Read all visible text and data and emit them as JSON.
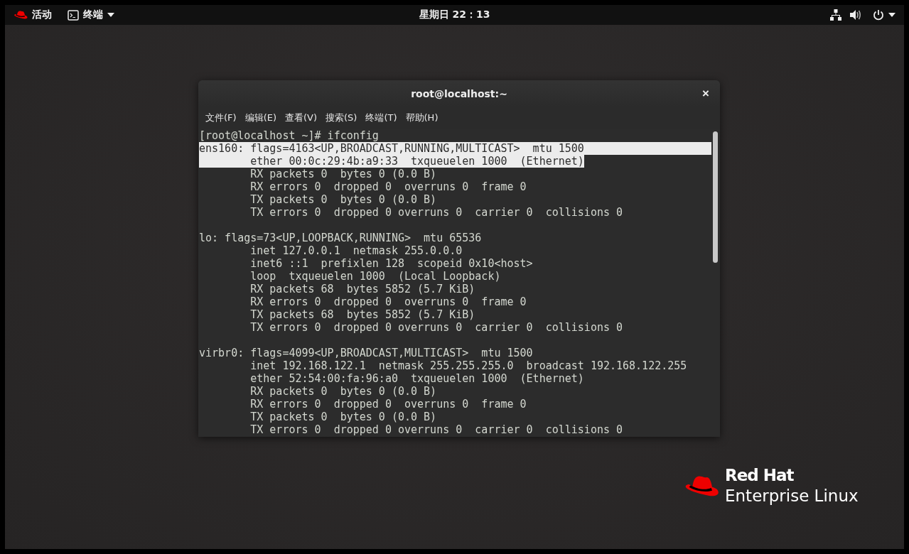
{
  "top_bar": {
    "activities": "活动",
    "app_menu": "终端",
    "clock": "星期日 22：13"
  },
  "window": {
    "title": "root@localhost:~",
    "close": "×",
    "menu": [
      "文件(F)",
      "编辑(E)",
      "查看(V)",
      "搜索(S)",
      "终端(T)",
      "帮助(H)"
    ],
    "lines": [
      {
        "kind": "text",
        "text": "[root@localhost ~]# ifconfig",
        "selected": false
      },
      {
        "kind": "text",
        "text": "ens160: flags=4163<UP,BROADCAST,RUNNING,MULTICAST>  mtu 1500",
        "selected": true
      },
      {
        "kind": "text",
        "text": "        ether 00:0c:29:4b:a9:33  txqueuelen 1000  (Ethernet)",
        "selected": true
      },
      {
        "kind": "text",
        "text": "        RX packets 0  bytes 0 (0.0 B)",
        "selected": false
      },
      {
        "kind": "text",
        "text": "        RX errors 0  dropped 0  overruns 0  frame 0",
        "selected": false
      },
      {
        "kind": "text",
        "text": "        TX packets 0  bytes 0 (0.0 B)",
        "selected": false
      },
      {
        "kind": "text",
        "text": "        TX errors 0  dropped 0 overruns 0  carrier 0  collisions 0",
        "selected": false
      },
      {
        "kind": "blank",
        "selected": false
      },
      {
        "kind": "text",
        "text": "lo: flags=73<UP,LOOPBACK,RUNNING>  mtu 65536",
        "selected": false
      },
      {
        "kind": "text",
        "text": "        inet 127.0.0.1  netmask 255.0.0.0",
        "selected": false
      },
      {
        "kind": "text",
        "text": "        inet6 ::1  prefixlen 128  scopeid 0x10<host>",
        "selected": false
      },
      {
        "kind": "text",
        "text": "        loop  txqueuelen 1000  (Local Loopback)",
        "selected": false
      },
      {
        "kind": "text",
        "text": "        RX packets 68  bytes 5852 (5.7 KiB)",
        "selected": false
      },
      {
        "kind": "text",
        "text": "        RX errors 0  dropped 0  overruns 0  frame 0",
        "selected": false
      },
      {
        "kind": "text",
        "text": "        TX packets 68  bytes 5852 (5.7 KiB)",
        "selected": false
      },
      {
        "kind": "text",
        "text": "        TX errors 0  dropped 0 overruns 0  carrier 0  collisions 0",
        "selected": false
      },
      {
        "kind": "blank",
        "selected": false
      },
      {
        "kind": "text",
        "text": "virbr0: flags=4099<UP,BROADCAST,MULTICAST>  mtu 1500",
        "selected": false
      },
      {
        "kind": "text",
        "text": "        inet 192.168.122.1  netmask 255.255.255.0  broadcast 192.168.122.255",
        "selected": false
      },
      {
        "kind": "text",
        "text": "        ether 52:54:00:fa:96:a0  txqueuelen 1000  (Ethernet)",
        "selected": false
      },
      {
        "kind": "text",
        "text": "        RX packets 0  bytes 0 (0.0 B)",
        "selected": false
      },
      {
        "kind": "text",
        "text": "        RX errors 0  dropped 0  overruns 0  frame 0",
        "selected": false
      },
      {
        "kind": "text",
        "text": "        TX packets 0  bytes 0 (0.0 B)",
        "selected": false
      },
      {
        "kind": "text",
        "text": "        TX errors 0  dropped 0 overruns 0  carrier 0  collisions 0",
        "selected": false
      }
    ]
  },
  "logo": {
    "brand": "Red Hat",
    "product": "Enterprise Linux"
  }
}
